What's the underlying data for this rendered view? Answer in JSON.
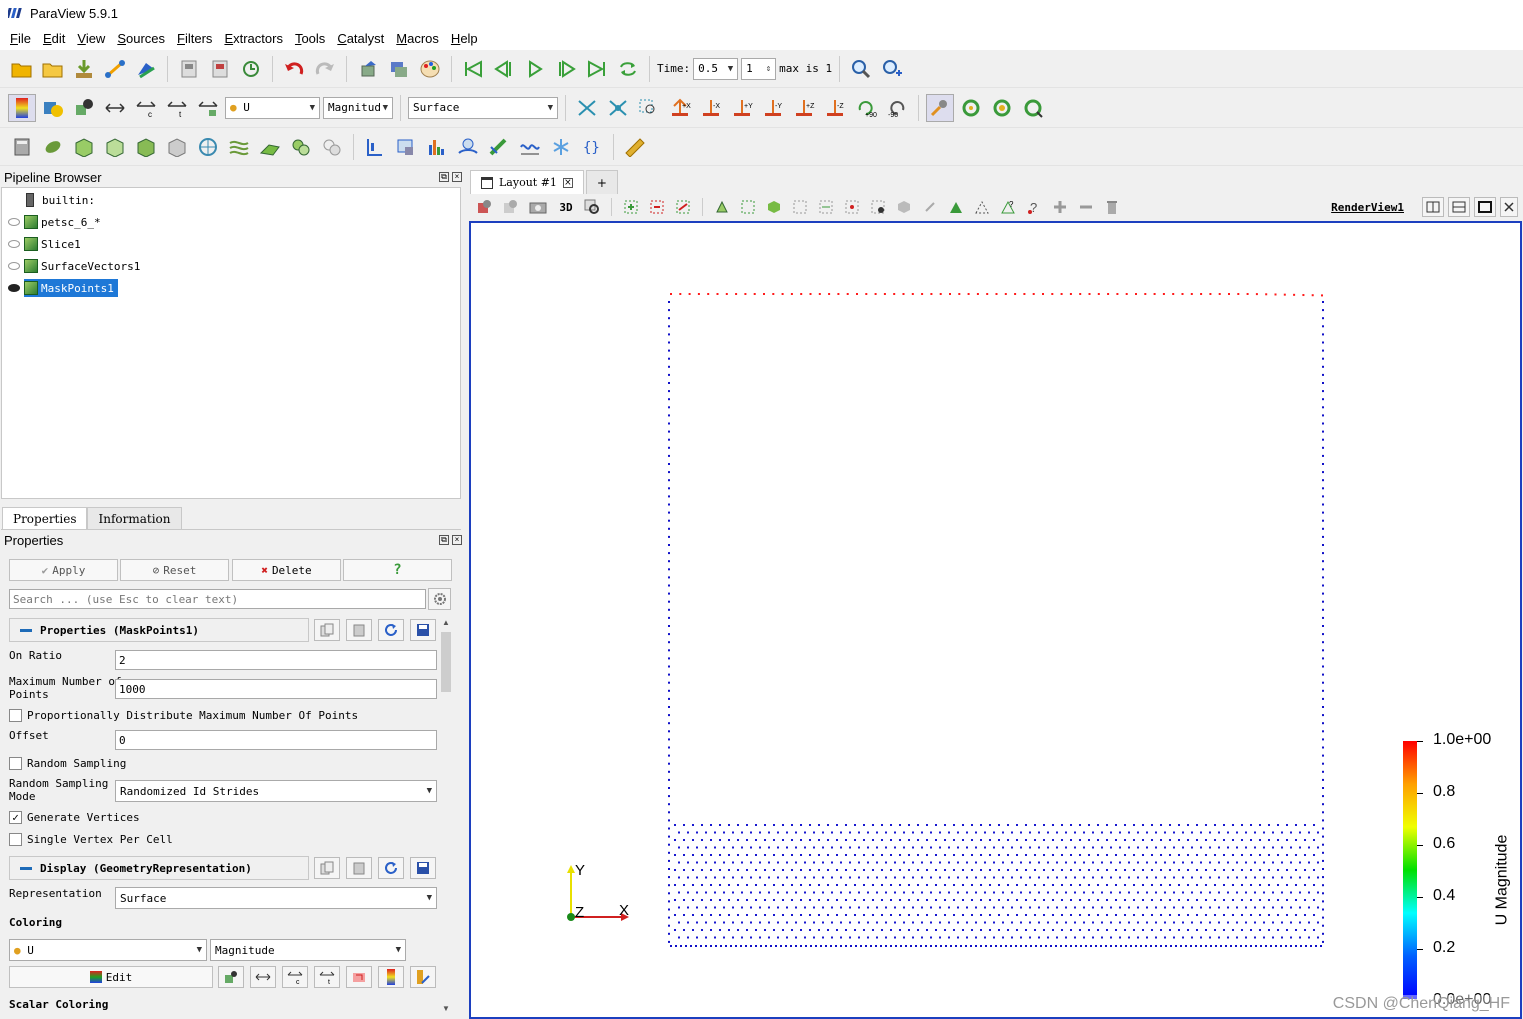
{
  "window": {
    "title": "ParaView 5.9.1"
  },
  "menu": [
    "File",
    "Edit",
    "View",
    "Sources",
    "Filters",
    "Extractors",
    "Tools",
    "Catalyst",
    "Macros",
    "Help"
  ],
  "time": {
    "label": "Time:",
    "value": "0.5",
    "step": "1",
    "max_text": "max is 1"
  },
  "toolbar2": {
    "array": "U",
    "component": "Magnitude",
    "representation": "Surface"
  },
  "pipeline": {
    "title": "Pipeline Browser",
    "items": [
      "builtin:",
      "petsc_6_*",
      "Slice1",
      "SurfaceVectors1",
      "MaskPoints1"
    ]
  },
  "layout": {
    "tab_label": "Layout #1",
    "add": "+",
    "view_name": "RenderView1",
    "three_d": "3D"
  },
  "tabs": {
    "properties": "Properties",
    "information": "Information"
  },
  "properties": {
    "title": "Properties",
    "apply": "Apply",
    "reset": "Reset",
    "delete": "Delete",
    "help": "?",
    "search_placeholder": "Search ... (use Esc to clear text)",
    "section1": "Properties (MaskPoints1)",
    "on_ratio_label": "On Ratio",
    "on_ratio": "2",
    "max_points_label_1": "Maximum Number of",
    "max_points_label_2": "Points",
    "max_points": "1000",
    "prop_distribute": "Proportionally Distribute Maximum Number Of Points",
    "offset_label": "Offset",
    "offset": "0",
    "random_sampling": "Random Sampling",
    "sampling_mode_label_1": "Random Sampling",
    "sampling_mode_label_2": "Mode",
    "sampling_mode": "Randomized Id Strides",
    "generate_vertices": "Generate Vertices",
    "single_vertex": "Single Vertex Per Cell",
    "section2": "Display (GeometryRepresentation)",
    "representation_label": "Representation",
    "representation": "Surface",
    "coloring_label": "Coloring",
    "color_array": "U",
    "color_component": "Magnitude",
    "edit": "Edit",
    "scalar_coloring": "Scalar Coloring"
  },
  "scalar_bar": {
    "title": "U Magnitude",
    "ticks": [
      "1.0e+00",
      "0.8",
      "0.6",
      "0.4",
      "0.2",
      "0.0e+00"
    ]
  },
  "axes": {
    "y": "Y",
    "z": "Z",
    "x": "X"
  },
  "watermark": "CSDN @ChenQiang_HF",
  "checks": {
    "prop_distribute": false,
    "random_sampling": false,
    "generate_vertices": true,
    "single_vertex": false
  }
}
